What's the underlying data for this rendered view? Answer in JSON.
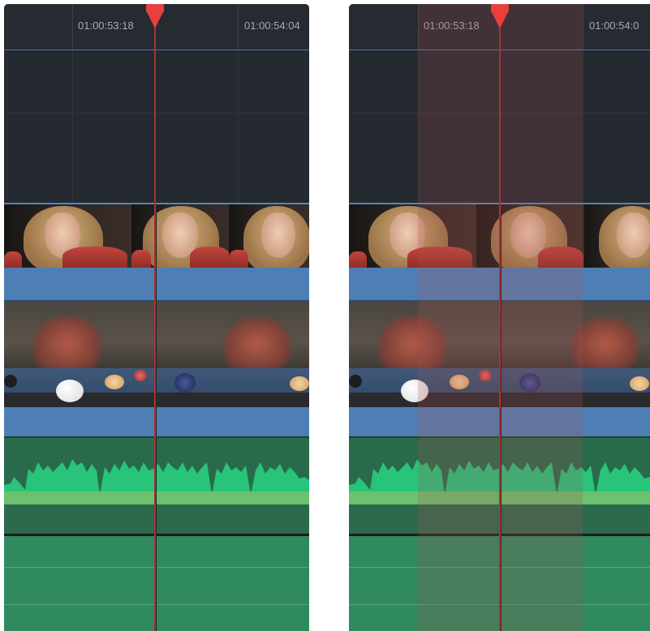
{
  "panels": [
    {
      "id": "left",
      "timecodes": [
        "01:00:53:18",
        "01:00:54:04"
      ],
      "range_selected": false
    },
    {
      "id": "right",
      "timecodes": [
        "01:00:53:18",
        "01:00:54:0"
      ],
      "range_selected": true
    }
  ],
  "colors": {
    "playhead": "#e8403d",
    "video_track": "#4d7fb5",
    "audio_track": "#2a6a4c",
    "audio_wave": "#27c47a",
    "range_highlight": "#aa5050"
  }
}
